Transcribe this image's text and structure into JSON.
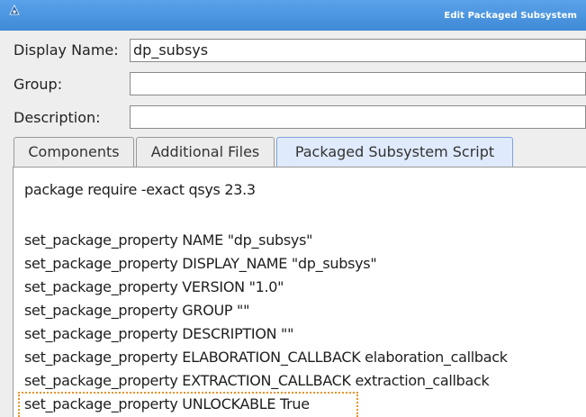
{
  "window": {
    "title": "Edit Packaged Subsystem",
    "icon": "app-triangle-icon"
  },
  "form": {
    "display_name_label": "Display Name:",
    "display_name_value": "dp_subsys",
    "group_label": "Group:",
    "group_value": "",
    "description_label": "Description:",
    "description_value": ""
  },
  "tabs": [
    {
      "label": "Components",
      "active": false
    },
    {
      "label": "Additional Files",
      "active": false
    },
    {
      "label": "Packaged Subsystem Script",
      "active": true
    }
  ],
  "script": {
    "lines": [
      "package require -exact qsys 23.3",
      "",
      "set_package_property NAME \"dp_subsys\"",
      "set_package_property DISPLAY_NAME \"dp_subsys\"",
      "set_package_property VERSION \"1.0\"",
      "set_package_property GROUP \"\"",
      "set_package_property DESCRIPTION \"\"",
      "set_package_property ELABORATION_CALLBACK elaboration_callback",
      "set_package_property EXTRACTION_CALLBACK extraction_callback",
      "set_package_property UNLOCKABLE True"
    ]
  },
  "colors": {
    "titlebar": "#4a96e0",
    "active_tab": "#dfeafc",
    "highlight": "#e8922a"
  }
}
